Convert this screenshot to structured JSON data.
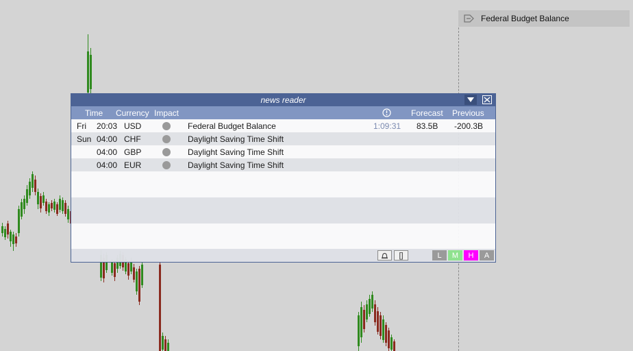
{
  "event_marker": {
    "label": "Federal Budget Balance",
    "icon": "event-flag-icon"
  },
  "window": {
    "title": "news reader",
    "dropdown_icon": "triangle-down-icon",
    "close_icon": "close-icon",
    "columns": {
      "time": "Time",
      "currency": "Currency",
      "impact": "Impact",
      "countdown_icon": "clock-icon",
      "forecast": "Forecast",
      "previous": "Previous"
    },
    "rows": [
      {
        "day": "Fri",
        "time": "20:03",
        "currency": "USD",
        "impact": "low",
        "event": "Federal Budget Balance",
        "countdown": "1:09:31",
        "forecast": "83.5B",
        "previous": "-200.3B"
      },
      {
        "day": "Sun",
        "time": "04:00",
        "currency": "CHF",
        "impact": "low",
        "event": "Daylight Saving Time Shift",
        "countdown": "",
        "forecast": "",
        "previous": ""
      },
      {
        "day": "",
        "time": "04:00",
        "currency": "GBP",
        "impact": "low",
        "event": "Daylight Saving Time Shift",
        "countdown": "",
        "forecast": "",
        "previous": ""
      },
      {
        "day": "",
        "time": "04:00",
        "currency": "EUR",
        "impact": "low",
        "event": "Daylight Saving Time Shift",
        "countdown": "",
        "forecast": "",
        "previous": ""
      }
    ],
    "footer": {
      "tools": [
        {
          "name": "bell-icon",
          "label": ""
        },
        {
          "name": "bracket-icon",
          "label": "[]"
        }
      ],
      "filters": [
        {
          "label": "L",
          "color": "#9a9a9a"
        },
        {
          "label": "M",
          "color": "#8fe28f"
        },
        {
          "label": "H",
          "color": "#ff00ff"
        },
        {
          "label": "A",
          "color": "#9a9a9a"
        }
      ]
    }
  },
  "colors": {
    "title_bar": "#4c6395",
    "header_bar": "#8196c2",
    "candle_up": "#2f8a1e",
    "candle_down": "#8a2a1e",
    "impact_low": "#9a9a9a"
  }
}
